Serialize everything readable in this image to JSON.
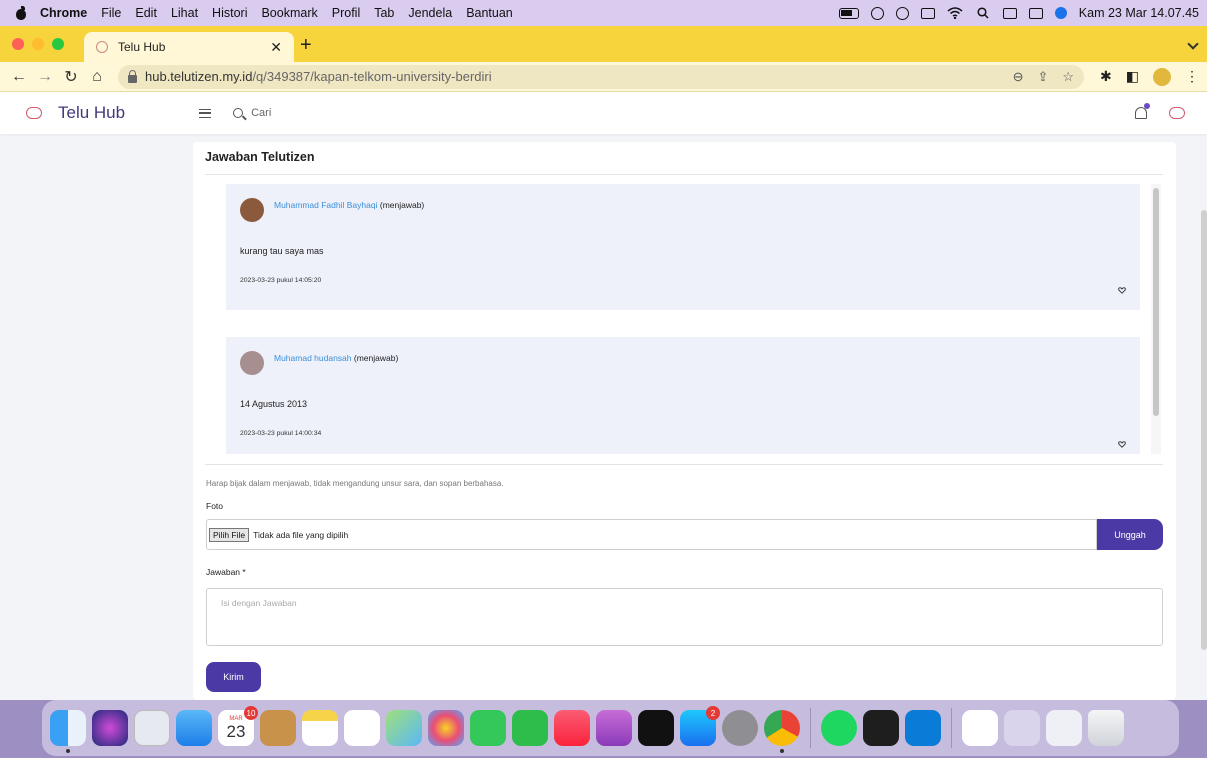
{
  "menubar": {
    "items": [
      "Chrome",
      "File",
      "Edit",
      "Lihat",
      "Histori",
      "Bookmark",
      "Profil",
      "Tab",
      "Jendela",
      "Bantuan"
    ],
    "clock": "Kam 23 Mar  14.07.45"
  },
  "browser": {
    "tab_title": "Telu Hub",
    "new_tab": "+",
    "url_domain": "hub.telutizen.my.id",
    "url_path": "/q/349387/kapan-telkom-university-berdiri"
  },
  "app": {
    "brand": "Telu Hub",
    "search_placeholder": "Cari"
  },
  "section": {
    "title": "Jawaban Telutizen"
  },
  "answers": [
    {
      "name": "Muhammad Fadhil Bayhaqi",
      "suffix": "(menjawab)",
      "body": "kurang tau saya mas",
      "timestamp": "2023-03-23 pukul 14:05:20"
    },
    {
      "name": "Muhamad hudansah",
      "suffix": "(menjawab)",
      "body": "14 Agustus 2013",
      "timestamp": "2023-03-23 pukul 14:00:34"
    }
  ],
  "form": {
    "note": "Harap bijak dalam menjawab, tidak mengandung unsur sara, dan sopan berbahasa.",
    "photo_label": "Foto",
    "file_button": "Pilih File",
    "file_status": "Tidak ada file yang dipilih",
    "upload_button": "Unggah",
    "answer_label": "Jawaban *",
    "answer_placeholder": "Isi dengan Jawaban",
    "submit_button": "Kirim"
  },
  "dock": {
    "calendar_month": "MAR",
    "calendar_day": "23",
    "calendar_badge": "10",
    "appstore_badge": "2",
    "apps": [
      "finder",
      "siri",
      "launchpad",
      "mail",
      "calendar",
      "contacts",
      "notes",
      "reminders",
      "maps",
      "photos",
      "messages",
      "facetime",
      "music",
      "podcasts",
      "tv",
      "app-store",
      "system-preferences",
      "chrome",
      "spotify",
      "terminal",
      "vscode",
      "telu-hub-window",
      "chrome-window-1",
      "chrome-window-2",
      "trash"
    ]
  }
}
